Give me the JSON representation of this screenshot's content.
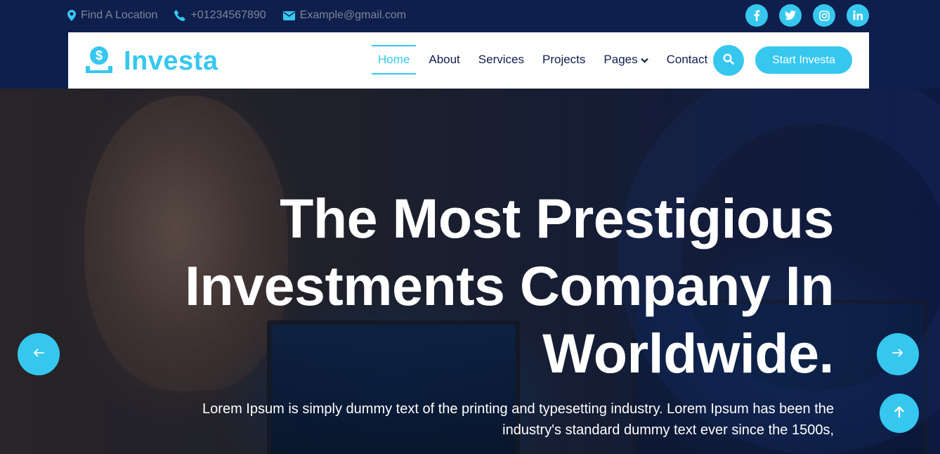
{
  "topbar": {
    "location": "Find A Location",
    "phone": "+01234567890",
    "email": "Example@gmail.com",
    "socials": [
      "facebook-icon",
      "twitter-icon",
      "instagram-icon",
      "linkedin-icon"
    ]
  },
  "navbar": {
    "brand": "Investa",
    "menu": [
      "Home",
      "About",
      "Services",
      "Projects",
      "Pages",
      "Contact"
    ],
    "active": "Home",
    "cta": "Start Investa"
  },
  "hero": {
    "title_line1": "The Most Prestigious",
    "title_line2": "Investments Company In",
    "title_line3": "Worldwide.",
    "subtitle_line1": "Lorem Ipsum is simply dummy text of the printing and typesetting industry. Lorem Ipsum has been the",
    "subtitle_line2": "industry's standard dummy text ever since the 1500s,"
  },
  "colors": {
    "accent": "#36c7ef",
    "navy": "#0e1f4d",
    "topbar_text": "#7d8597"
  }
}
